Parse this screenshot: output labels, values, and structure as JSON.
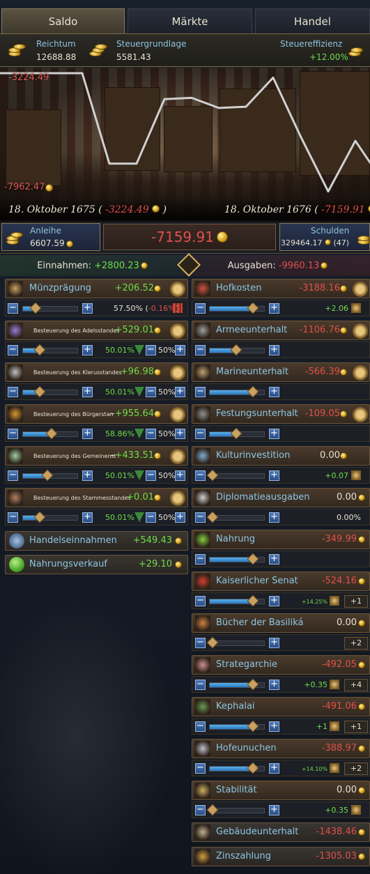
{
  "tabs": [
    "Saldo",
    "Märkte",
    "Handel"
  ],
  "stats": {
    "wealth_label": "Reichtum",
    "wealth_value": "12688.88",
    "taxbase_label": "Steuergrundlage",
    "taxbase_value": "5581.43",
    "efficiency_label": "Steuereffizienz",
    "efficiency_value": "+12.00%"
  },
  "chart": {
    "top_label": "-3224.49",
    "bottom_label": "-7962.47",
    "date_left": "18. Oktober 1675 (",
    "date_left_val": "-3224.49",
    "date_left_close": ")",
    "date_right": "18. Oktober 1676 (",
    "date_right_val": "-7159.91",
    "date_right_close": ")"
  },
  "chart_data": {
    "type": "line",
    "x": [
      "18. Oktober 1675",
      "",
      "",
      "",
      "",
      "",
      "",
      "",
      "",
      "",
      "",
      "",
      "18. Oktober 1676"
    ],
    "series": [
      {
        "values": [
          -3224.49,
          -3224.49,
          -6800,
          -6800,
          -4250,
          -4200,
          -4600,
          -4550,
          -3400,
          -5700,
          -7900,
          -5900,
          -7159.91
        ]
      }
    ],
    "ylim": [
      -7962.47,
      -3224.49
    ],
    "line_color": "#d0d0d0"
  },
  "loan": {
    "label": "Anleihe",
    "value": "6607.59"
  },
  "balance": "-7159.91",
  "debt": {
    "label": "Schulden",
    "value": "329464.17",
    "count": "(47)"
  },
  "summary": {
    "income_label": "Einnahmen:",
    "income_value": "+2800.23",
    "expense_label": "Ausgaben:",
    "expense_value": "-9960.13"
  },
  "income": [
    {
      "name": "Münzprägung",
      "value": "+206.52",
      "pct": "57.50% (",
      "pct_delta": "-0.16%",
      "pct_close": ")",
      "slider": 0.2
    },
    {
      "name": "Besteuerung des Adelsstandes",
      "value": "+529.01",
      "pct": "50.01%",
      "rate": "50%",
      "slider": 0.3
    },
    {
      "name": "Besteuerung des Klerusstandes",
      "value": "+96.98",
      "pct": "50.01%",
      "rate": "50%",
      "slider": 0.3
    },
    {
      "name": "Besteuerung des Bürgerstan",
      "dash": "–",
      "value": "+955.64",
      "pct": "58.86%",
      "rate": "50%",
      "slider": 0.55
    },
    {
      "name": "Besteuerung des Gemeinenst",
      "dash": "–",
      "value": "+433.51",
      "pct": "50.01%",
      "rate": "50%",
      "slider": 0.45
    },
    {
      "name": "Besteuerung des Stammesstandes",
      "value": "+0.01",
      "pct": "50.01%",
      "rate": "50%",
      "slider": 0.3
    },
    {
      "name": "Handelseinnahmen",
      "value": "+549.43"
    },
    {
      "name": "Nahrungsverkauf",
      "value": "+29.10"
    }
  ],
  "expenses": [
    {
      "name": "Hofkosten",
      "value": "-3188.16",
      "extra": "+2.06",
      "slider": 0.85
    },
    {
      "name": "Armeeunterhalt",
      "value": "-1106.76",
      "slider": 0.5
    },
    {
      "name": "Marineunterhalt",
      "value": "-566.39",
      "slider": 0.85
    },
    {
      "name": "Festungsunterhalt",
      "value": "-109.05",
      "slider": 0.5
    },
    {
      "name": "Kulturinvestition",
      "value": "0.00",
      "extra": "+0.07",
      "slider": 0.0
    },
    {
      "name": "Diplomatieausgaben",
      "value": "0.00",
      "extra": "0.00%",
      "slider": 0.0
    },
    {
      "name": "Nahrung",
      "value": "-349.99",
      "slider": 0.85
    },
    {
      "name": "Kaiserlicher Senat",
      "value": "-524.16",
      "extra": "+14.25%",
      "badge": "+1",
      "slider": 0.85
    },
    {
      "name": "Bücher der Basiliká",
      "value": "0.00",
      "badge": "+2",
      "slider": 0.0
    },
    {
      "name": "Strategarchie",
      "value": "-492.05",
      "extra": "+0.35",
      "badge": "+4",
      "slider": 0.85
    },
    {
      "name": "Kephalai",
      "value": "-491.06",
      "extra": "+1",
      "badge": "+1",
      "slider": 0.85
    },
    {
      "name": "Hofeunuchen",
      "value": "-388.97",
      "extra": "+14.10%",
      "badge": "+2",
      "slider": 0.85
    },
    {
      "name": "Stabilität",
      "value": "0.00",
      "extra": "+0.35",
      "slider": 0.0
    },
    {
      "name": "Gebäudeunterhalt",
      "value": "-1438.46"
    },
    {
      "name": "Zinszahlung",
      "value": "-1305.03"
    }
  ]
}
